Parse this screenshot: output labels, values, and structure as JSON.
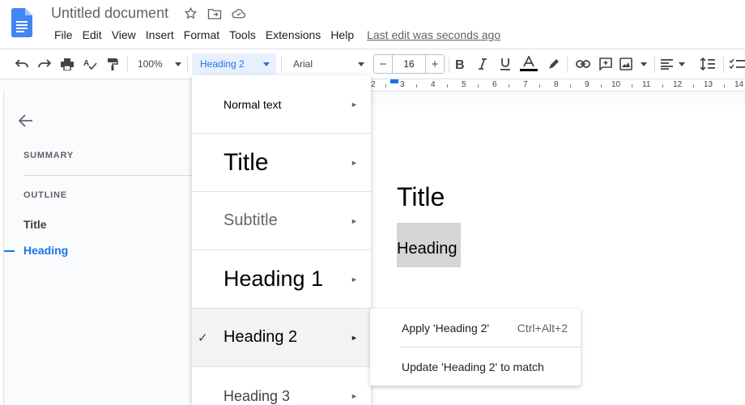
{
  "app": {
    "doc_title": "Untitled document",
    "last_edit": "Last edit was seconds ago",
    "brand_color": "#1a73e8"
  },
  "menubar": [
    "File",
    "Edit",
    "View",
    "Insert",
    "Format",
    "Tools",
    "Extensions",
    "Help"
  ],
  "toolbar": {
    "zoom": "100%",
    "style": "Heading 2",
    "font": "Arial",
    "font_size": "16",
    "minus": "−",
    "plus": "+",
    "icons": [
      "undo-icon",
      "redo-icon",
      "print-icon",
      "spellcheck-icon",
      "paint-format-icon",
      "bold-icon",
      "italic-icon",
      "underline-icon",
      "text-color-icon",
      "highlight-icon",
      "link-icon",
      "comment-icon",
      "image-icon",
      "align-icon",
      "line-spacing-icon",
      "checklist-icon"
    ]
  },
  "ruler": [
    "2",
    "3",
    "4",
    "5",
    "6",
    "7",
    "8",
    "9",
    "10",
    "11",
    "12",
    "13",
    "14"
  ],
  "outline_panel": {
    "summary_label": "SUMMARY",
    "outline_label": "OUTLINE",
    "items": [
      {
        "label": "Title",
        "active": false
      },
      {
        "label": "Heading",
        "active": true
      }
    ]
  },
  "document": {
    "title": "Title",
    "heading": "Heading"
  },
  "style_menu": {
    "items": [
      {
        "label": "Normal text",
        "font_size": 14
      },
      {
        "label": "Title",
        "font_size": 30
      },
      {
        "label": "Subtitle",
        "font_size": 20,
        "color": "#666666"
      },
      {
        "label": "Heading 1",
        "font_size": 27
      },
      {
        "label": "Heading 2",
        "font_size": 20,
        "selected": true
      },
      {
        "label": "Heading 3",
        "font_size": 18,
        "color": "#434343"
      }
    ],
    "check": "✓",
    "arrow": "►"
  },
  "submenu": {
    "apply_label": "Apply 'Heading 2'",
    "apply_shortcut": "Ctrl+Alt+2",
    "update_label": "Update 'Heading 2' to match"
  }
}
